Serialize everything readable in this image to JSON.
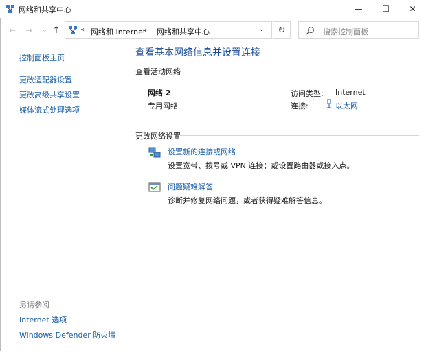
{
  "window": {
    "title": "网络和共享中心",
    "minimize": "—",
    "maximize": "☐",
    "close": "✕"
  },
  "nav": {
    "back": "←",
    "forward": "→",
    "recent": "⌄",
    "up": "↑",
    "breadcrumb_overflow": "«",
    "breadcrumb": [
      "网络和 Internet",
      "网络和共享中心"
    ],
    "separator": "›",
    "dropdown": "⌄",
    "refresh": "↻",
    "search_placeholder": "搜索控制面板"
  },
  "sidebar": {
    "items": [
      "控制面板主页",
      "更改适配器设置",
      "更改高级共享设置",
      "媒体流式处理选项"
    ],
    "see_also_heading": "另请参阅",
    "see_also": [
      "Internet 选项",
      "Windows Defender 防火墙"
    ]
  },
  "main": {
    "title": "查看基本网络信息并设置连接",
    "active_heading": "查看活动网络",
    "network": {
      "name": "网络 2",
      "type": "专用网络",
      "access_label": "访问类型:",
      "access_value": "Internet",
      "conn_label": "连接:",
      "conn_value": "以太网"
    },
    "change_heading": "更改网络设置",
    "tasks": [
      {
        "link": "设置新的连接或网络",
        "desc": "设置宽带、拨号或 VPN 连接；或设置路由器或接入点。"
      },
      {
        "link": "问题疑难解答",
        "desc": "诊断并修复网络问题，或者获得疑难解答信息。"
      }
    ]
  },
  "colors": {
    "link": "#1a5ea8",
    "title": "#1c4f99",
    "muted": "#7a7a7a"
  }
}
